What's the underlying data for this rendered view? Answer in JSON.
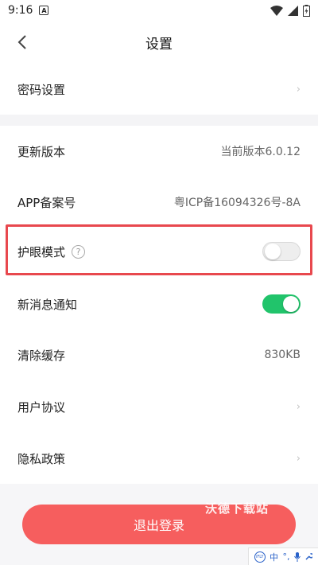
{
  "status_bar": {
    "time": "9:16",
    "notification_icon": "A"
  },
  "nav": {
    "title": "设置",
    "back_icon": "chevron-left-icon"
  },
  "settings": {
    "password": {
      "label": "密码设置"
    },
    "version": {
      "label": "更新版本",
      "value": "当前版本6.0.12"
    },
    "icp": {
      "label": "APP备案号",
      "value": "粤ICP备16094326号-8A"
    },
    "eye_mode": {
      "label": "护眼模式",
      "help": "?",
      "enabled": false
    },
    "notifications": {
      "label": "新消息通知",
      "enabled": true
    },
    "cache": {
      "label": "清除缓存",
      "value": "830KB"
    },
    "agreement": {
      "label": "用户协议"
    },
    "privacy": {
      "label": "隐私政策"
    }
  },
  "logout": {
    "label": "退出登录"
  },
  "watermark": "沃德下载站",
  "ime": {
    "brand": "iFLY",
    "lang": "中",
    "punct": "°,",
    "mic_icon": "microphone-icon",
    "settings_icon": "wrench-icon"
  },
  "colors": {
    "accent_red": "#f65e5e",
    "highlight_red": "#e8484e",
    "toggle_green": "#21c46b",
    "section_gap": "#f4f4f6"
  }
}
